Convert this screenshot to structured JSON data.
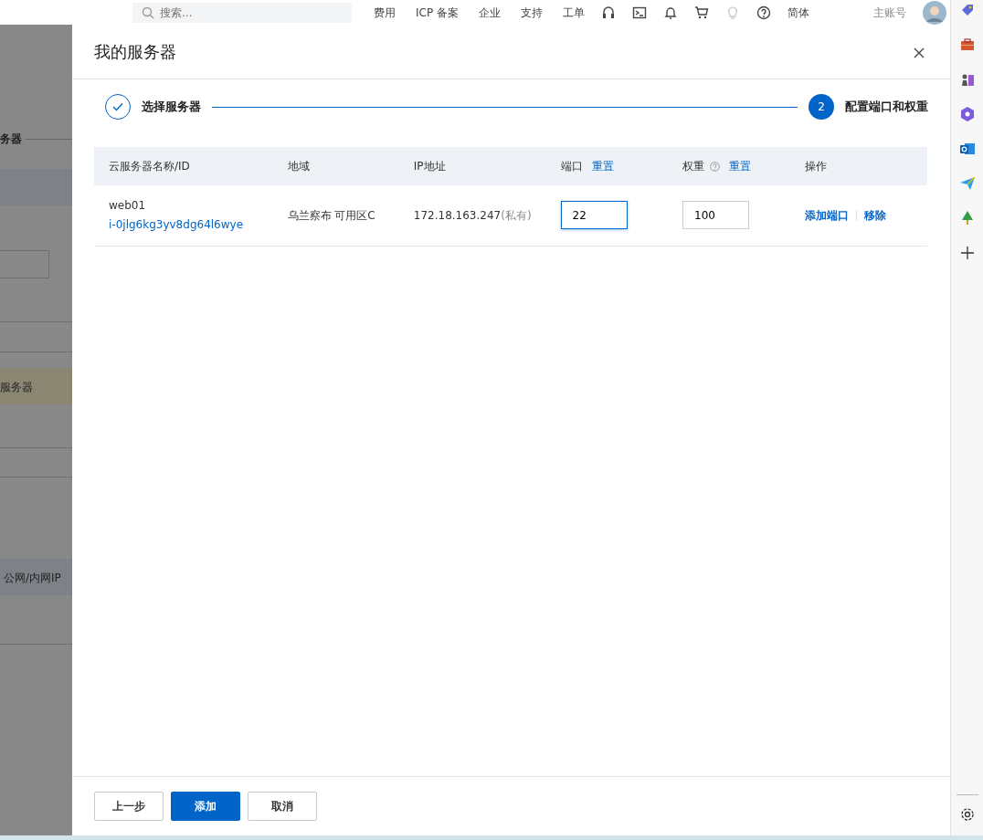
{
  "topbar": {
    "search": {
      "placeholder": "搜索..."
    },
    "nav": [
      "费用",
      "ICP 备案",
      "企业",
      "支持",
      "工单"
    ],
    "language": "简体",
    "account": "主账号"
  },
  "background": {
    "section_title": "务器",
    "highlight_row": "服务器",
    "table_header": "公网/内网IP"
  },
  "modal": {
    "title": "我的服务器",
    "steps": [
      {
        "label": "选择服务器",
        "completed": true
      },
      {
        "label": "配置端口和权重",
        "completed": false,
        "number": "2"
      }
    ],
    "columns": [
      {
        "label": "云服务器名称/ID"
      },
      {
        "label": "地域"
      },
      {
        "label": "IP地址"
      },
      {
        "label": "端口",
        "help": false,
        "action": "重置"
      },
      {
        "label": "权重",
        "help": true,
        "action": "重置"
      },
      {
        "label": "操作"
      }
    ],
    "rows": [
      {
        "name": "web01",
        "id": "i-0jlg6kg3yv8dg64l6wye",
        "region": "乌兰察布 可用区C",
        "ip": "172.18.163.247",
        "ip_note": "(私有)",
        "port": {
          "value": "22",
          "focused": true
        },
        "weight": {
          "value": "100",
          "focused": false
        },
        "actions": [
          "添加端口",
          "移除"
        ]
      }
    ],
    "buttons": [
      {
        "label": "上一步",
        "kind": "default"
      },
      {
        "label": "添加",
        "kind": "primary"
      },
      {
        "label": "取消",
        "kind": "default"
      }
    ]
  }
}
